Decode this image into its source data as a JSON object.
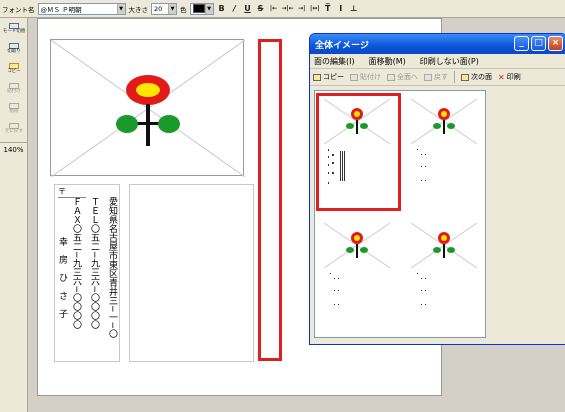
{
  "toolbar": {
    "font_label": "フォント名",
    "font_value": "@ＭＳ Ｐ明朝",
    "size_label": "大きさ",
    "size_value": "20",
    "color_label": "色",
    "bold": "B",
    "italic": "/",
    "underline": "U",
    "strike": "S",
    "align_left": "|←",
    "align_center": "→|←",
    "align_right": "→|",
    "align_justify": "|↔|",
    "valign_top": "T̅",
    "valign_middle": "I",
    "valign_bottom": "⊥"
  },
  "leftpanel": {
    "items": [
      {
        "label": "モード切替",
        "icon": "mode-switch-icon",
        "enabled": true
      },
      {
        "label": "切取り",
        "icon": "cut-icon",
        "enabled": true
      },
      {
        "label": "コピー",
        "icon": "copy-icon",
        "enabled": true
      },
      {
        "label": "貼付け",
        "icon": "paste-icon",
        "enabled": false
      },
      {
        "label": "削除",
        "icon": "delete-icon",
        "enabled": false
      },
      {
        "label": "元に戻す",
        "icon": "undo-icon",
        "enabled": false
      }
    ],
    "zoom": "140%"
  },
  "postcard": {
    "postal_symbol": "〒",
    "address": "愛知県名古屋市東区青井三−一−〇",
    "tel": "ＴＥＬ〇五二−九三六−〇〇〇〇",
    "fax": "ＦＡＸ〇五二−九三六−〇〇〇〇",
    "name": "幸　房　ひ　さ　子"
  },
  "overview": {
    "title": "全体イメージ",
    "menu": [
      "面の編集(I)",
      "面移動(M)",
      "印刷しない面(P)"
    ],
    "tools": {
      "copy": "コピー",
      "paste": "貼付け",
      "all": "全面へ",
      "back": "戻す",
      "next": "次の面",
      "print": "印刷"
    }
  },
  "colors": {
    "highlight": "#e0201e",
    "flower_petal": "#e21a1a",
    "flower_center": "#ffe600",
    "leaf": "#1a9a2a"
  }
}
